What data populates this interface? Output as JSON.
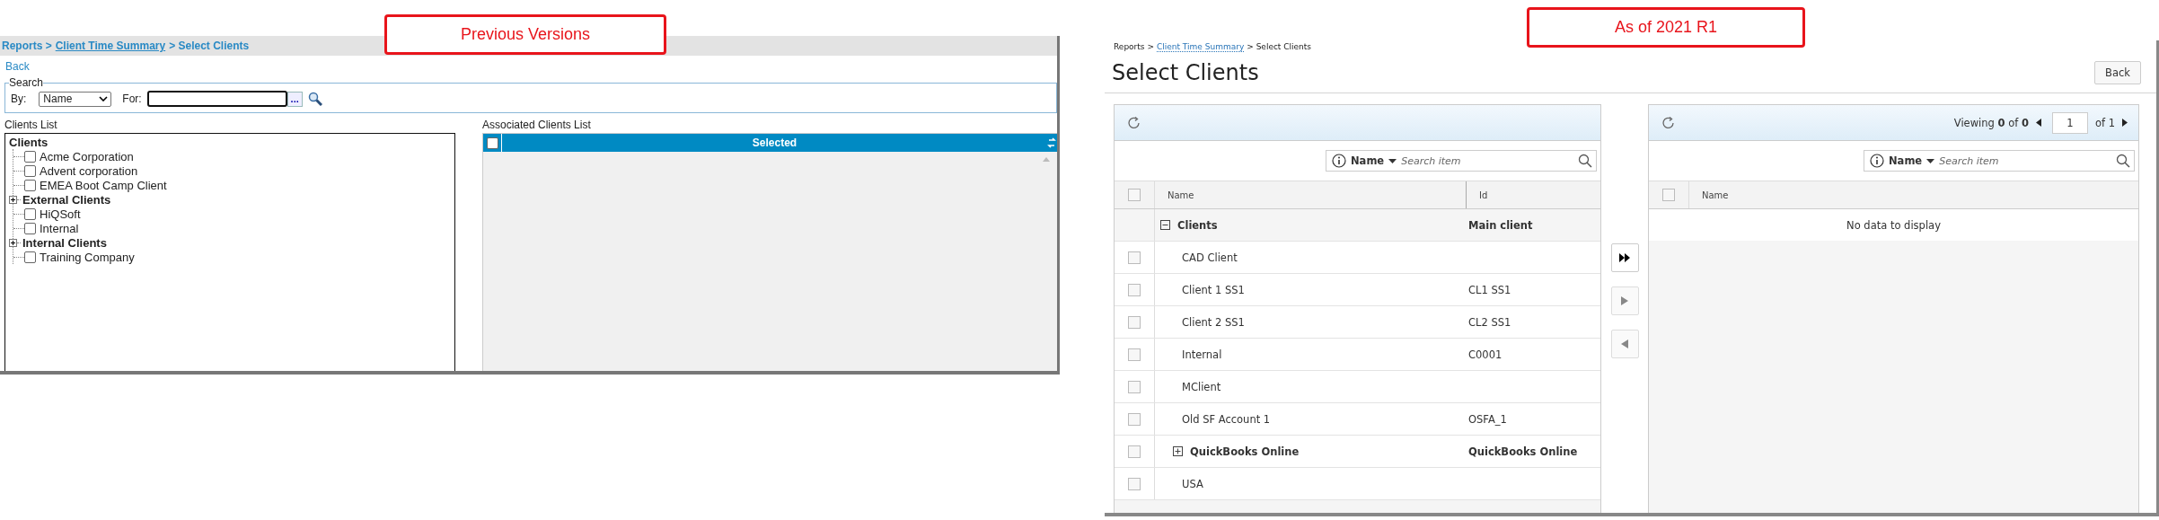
{
  "previous_versions": {
    "caption": "Previous Versions",
    "breadcrumb": [
      {
        "kind": "text",
        "text": "Reports >"
      },
      {
        "kind": "link",
        "text": "Client Time Summary"
      },
      {
        "kind": "text",
        "text": "> Select Clients"
      }
    ],
    "back_link": "Back",
    "search": {
      "legend": "Search",
      "by_label": "By:",
      "by_value": "Name",
      "for_label": "For:",
      "browse_button": "..."
    },
    "clients_list": {
      "title": "Clients List",
      "tree": [
        {
          "kind": "root",
          "label": "Clients",
          "children": [
            {
              "kind": "item",
              "label": "Acme Corporation",
              "checked": false
            },
            {
              "kind": "item",
              "label": "Advent corporation",
              "checked": false
            },
            {
              "kind": "item",
              "label": "EMEA Boot Camp Client",
              "checked": false
            },
            {
              "kind": "group",
              "label": "External Clients",
              "expanded": false
            },
            {
              "kind": "item",
              "label": "HiQSoft",
              "checked": false
            },
            {
              "kind": "item",
              "label": "Internal",
              "checked": false
            },
            {
              "kind": "group",
              "label": "Internal Clients",
              "expanded": false
            },
            {
              "kind": "item",
              "label": "Training Company",
              "checked": false
            }
          ]
        }
      ]
    },
    "associated_list": {
      "title": "Associated Clients List",
      "select_all_checked": false,
      "column": "Selected"
    }
  },
  "as_of_2021_r1": {
    "caption": "As of 2021 R1",
    "breadcrumb": [
      {
        "kind": "text",
        "text": "Reports >"
      },
      {
        "kind": "link",
        "text": "Client Time Summary"
      },
      {
        "kind": "text",
        "text": "> Select Clients"
      }
    ],
    "title": "Select Clients",
    "back_button": "Back",
    "clients_grid": {
      "search": {
        "field": "Name",
        "placeholder": "Search item"
      },
      "columns": [
        "Name",
        "Id"
      ],
      "select_all_checked": false,
      "rows": [
        {
          "kind": "group",
          "name": "Clients",
          "id": "Main client",
          "expanded": true,
          "children": [
            {
              "kind": "item",
              "name": "CAD Client",
              "checked": false
            },
            {
              "kind": "item",
              "name": "Client 1 SS1",
              "id": "CL1 SS1",
              "checked": false
            },
            {
              "kind": "item",
              "name": "Client 2 SS1",
              "id": "CL2 SS1",
              "checked": false
            },
            {
              "kind": "item",
              "name": "Internal",
              "id": "C0001",
              "checked": false
            },
            {
              "kind": "item",
              "name": "MClient",
              "checked": false
            },
            {
              "kind": "item",
              "name": "Old SF Account 1",
              "id": "OSFA_1",
              "checked": false
            },
            {
              "kind": "group",
              "name": "QuickBooks Online",
              "id": "QuickBooks Online",
              "expanded": false,
              "checked": false
            },
            {
              "kind": "item",
              "name": "USA",
              "checked": false
            }
          ]
        }
      ]
    },
    "move_buttons": [
      {
        "kind": "move_all",
        "disabled": false
      },
      {
        "kind": "move_selected",
        "disabled": true
      },
      {
        "kind": "remove_selected",
        "disabled": true
      }
    ],
    "selected_grid": {
      "pager": {
        "viewing": "Viewing **0** of **0**",
        "page": "1",
        "of_pages": "of 1"
      },
      "search": {
        "field": "Name",
        "placeholder": "Search item"
      },
      "columns": [
        "Name"
      ],
      "select_all_checked": false,
      "empty_text": "No data to display"
    }
  }
}
